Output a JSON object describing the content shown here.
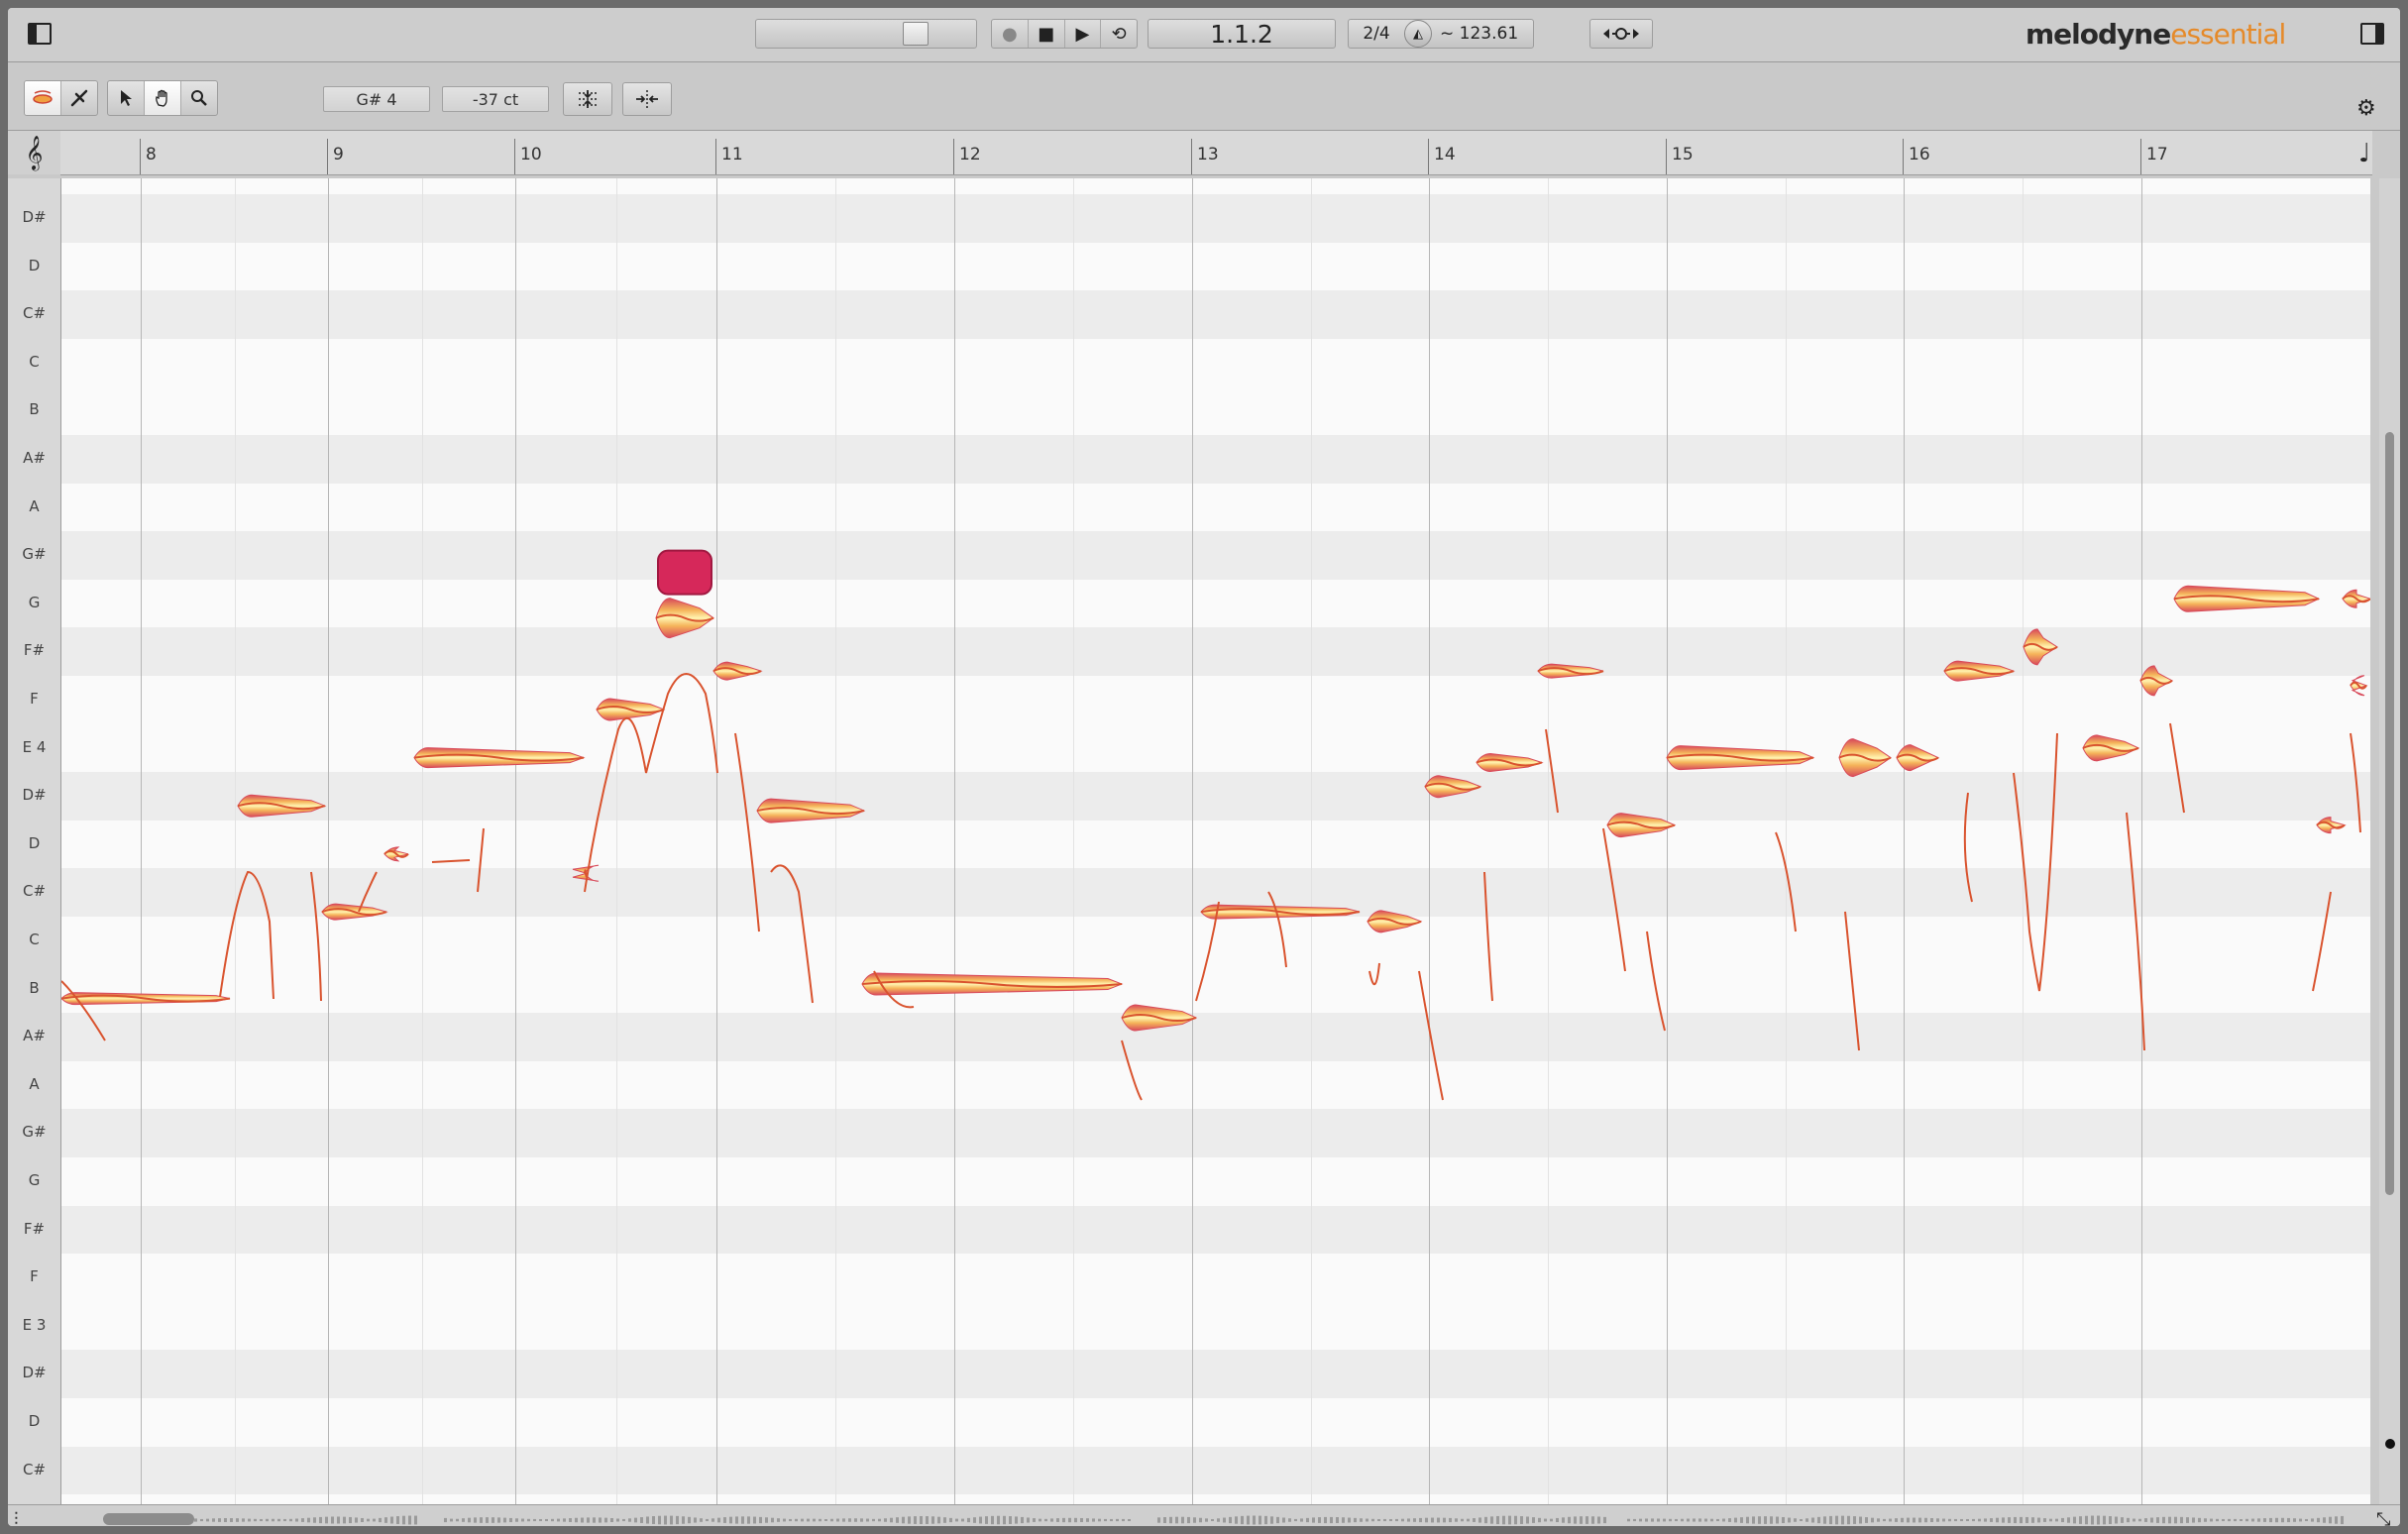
{
  "titlebar": {
    "left_panel_icon": "left-panel-icon",
    "right_panel_icon": "right-panel-icon",
    "position": "1.1.2",
    "meter": "2/4",
    "tempo": "~ 123.61",
    "logo_main": "melodyne",
    "logo_sub": "essential"
  },
  "transport": {
    "record_icon": "●",
    "stop_icon": "■",
    "play_icon": "▶",
    "loop_icon": "⟲"
  },
  "toolbar": {
    "pitch_field": "G# 4",
    "cents_field": "-37 ct"
  },
  "ruler": {
    "bars": [
      "8",
      "9",
      "10",
      "11",
      "12",
      "13",
      "14",
      "15",
      "16",
      "17"
    ]
  },
  "keys": [
    "D#",
    "D",
    "C#",
    "C",
    "B",
    "A#",
    "A",
    "G#",
    "G",
    "F#",
    "F",
    "E 4",
    "D#",
    "D",
    "C#",
    "C",
    "B",
    "A#",
    "A",
    "G#",
    "G",
    "F#",
    "F",
    "E 3",
    "D#",
    "D",
    "C#"
  ],
  "colors": {
    "blob_light": "#fff3b0",
    "blob_mid": "#f5b45a",
    "blob_edge": "#d84a5a",
    "pitch_line": "#d9532e",
    "selected_note": "#d6285a"
  }
}
